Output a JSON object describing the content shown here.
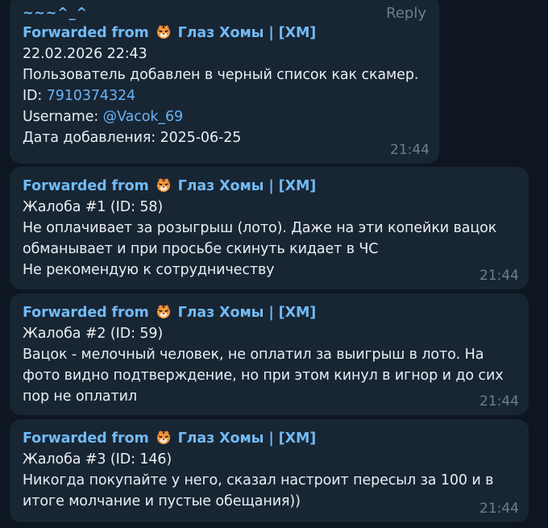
{
  "reply": {
    "sender_name": "~~~^_^",
    "button_label": "Reply"
  },
  "forward": {
    "prefix": "Forwarded from",
    "channel": "Глаз Хомы | [XM]",
    "emoji": "tiger-face-icon"
  },
  "messages": [
    {
      "lines": [
        "22.02.2026 22:43",
        "Пользователь добавлен в черный список как скамер."
      ],
      "id_label": "ID: ",
      "id_value": "7910374324",
      "username_label": "Username: ",
      "username_value": "@Vacok_69",
      "date_label": "Дата добавления: 2025-06-25",
      "time": "21:44"
    },
    {
      "lines": [
        "Жалоба #1 (ID: 58)",
        "Не оплачивает за розыгрыш (лото). Даже на эти копейки вацок",
        "обманывает и при просьбе скинуть кидает в ЧС",
        "Не рекомендую к сотрудничеству"
      ],
      "time": "21:44"
    },
    {
      "lines": [
        "Жалоба #2 (ID: 59)",
        "Вацок - мелочный человек, не оплатил за выигрыш в лото. На",
        "фото видно подтверждение, но при этом кинул в игнор и до сих",
        "пор не оплатил"
      ],
      "time": "21:44"
    },
    {
      "lines": [
        "Жалоба #3 (ID: 146)",
        "Никогда покупайте у него, сказал настроит пересыл за 100 и в",
        "итоге молчание и пустые обещания))"
      ],
      "time": "21:44"
    }
  ]
}
